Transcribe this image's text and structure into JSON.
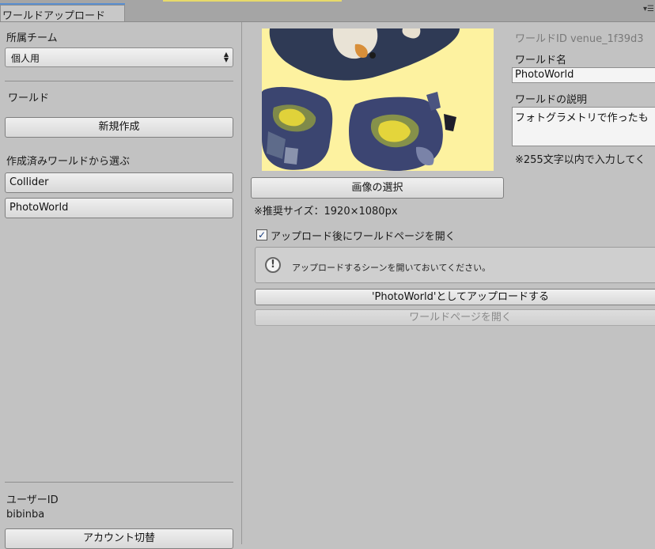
{
  "window": {
    "tab_title": "ワールドアップロード",
    "menu_icon": "panel-menu-icon"
  },
  "left": {
    "team_label": "所属チーム",
    "team_selected": "個人用",
    "world_section": "ワールド",
    "new_button": "新規作成",
    "existing_label": "作成済みワールドから選ぶ",
    "worlds": [
      "Collider",
      "PhotoWorld"
    ],
    "user_id_label": "ユーザーID",
    "user_id": "bibinba",
    "switch_account_button": "アカウント切替"
  },
  "right": {
    "image_select_button": "画像の選択",
    "recommended_size": "※推奨サイズ：1920×1080px",
    "world_id": "ワールドID venue_1f39d3",
    "world_name_label": "ワールド名",
    "world_name_value": "PhotoWorld",
    "description_label": "ワールドの説明",
    "description_value": "フォトグラメトリで作ったも",
    "char_limit_note": "※255文字以内で入力してく",
    "open_page_checkbox": "アップロード後にワールドページを開く",
    "open_page_checked": true,
    "info_message": "アップロードするシーンを開いておいてください。",
    "upload_button": "'PhotoWorld'としてアップロードする",
    "open_world_page_button": "ワールドページを開く"
  },
  "colors": {
    "panel": "#c2c2c2",
    "preview_background": "#fdf2a0",
    "tab_accent": "#5a8fd0"
  }
}
